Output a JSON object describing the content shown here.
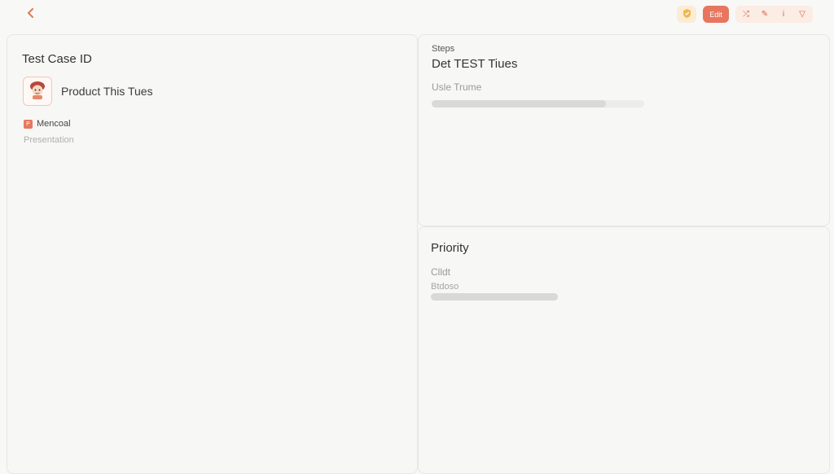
{
  "topbar": {
    "back_icon": "chevron-left-icon",
    "toolbar": {
      "badge_icon": "shield-icon",
      "primary_label": "Edit",
      "mini_actions": [
        {
          "icon": "shuffle-icon",
          "glyph": "⤮"
        },
        {
          "icon": "pencil-icon",
          "glyph": "✎"
        },
        {
          "icon": "info-icon",
          "glyph": "i"
        },
        {
          "icon": "filter-icon",
          "glyph": "▽"
        }
      ]
    }
  },
  "left_panel": {
    "title": "Test Case ID",
    "product": {
      "thumbnail_icon": "character-avatar-icon",
      "name": "Product This Tues"
    },
    "tag": {
      "icon_letter": "P",
      "label": "Mencoal",
      "sublabel": "Presentation"
    }
  },
  "right_top_panel": {
    "kicker": "Steps",
    "title": "Det TEST Tiues",
    "subtitle": "Usle Trume",
    "progress": 0.82
  },
  "right_bottom_panel": {
    "title": "Priority",
    "line1": "Clldt",
    "line2": "Btdoso",
    "progress": 1.0
  },
  "colors": {
    "accent": "#e8765f",
    "background": "#f8f8f7",
    "panel_border": "#e6e8e2"
  }
}
